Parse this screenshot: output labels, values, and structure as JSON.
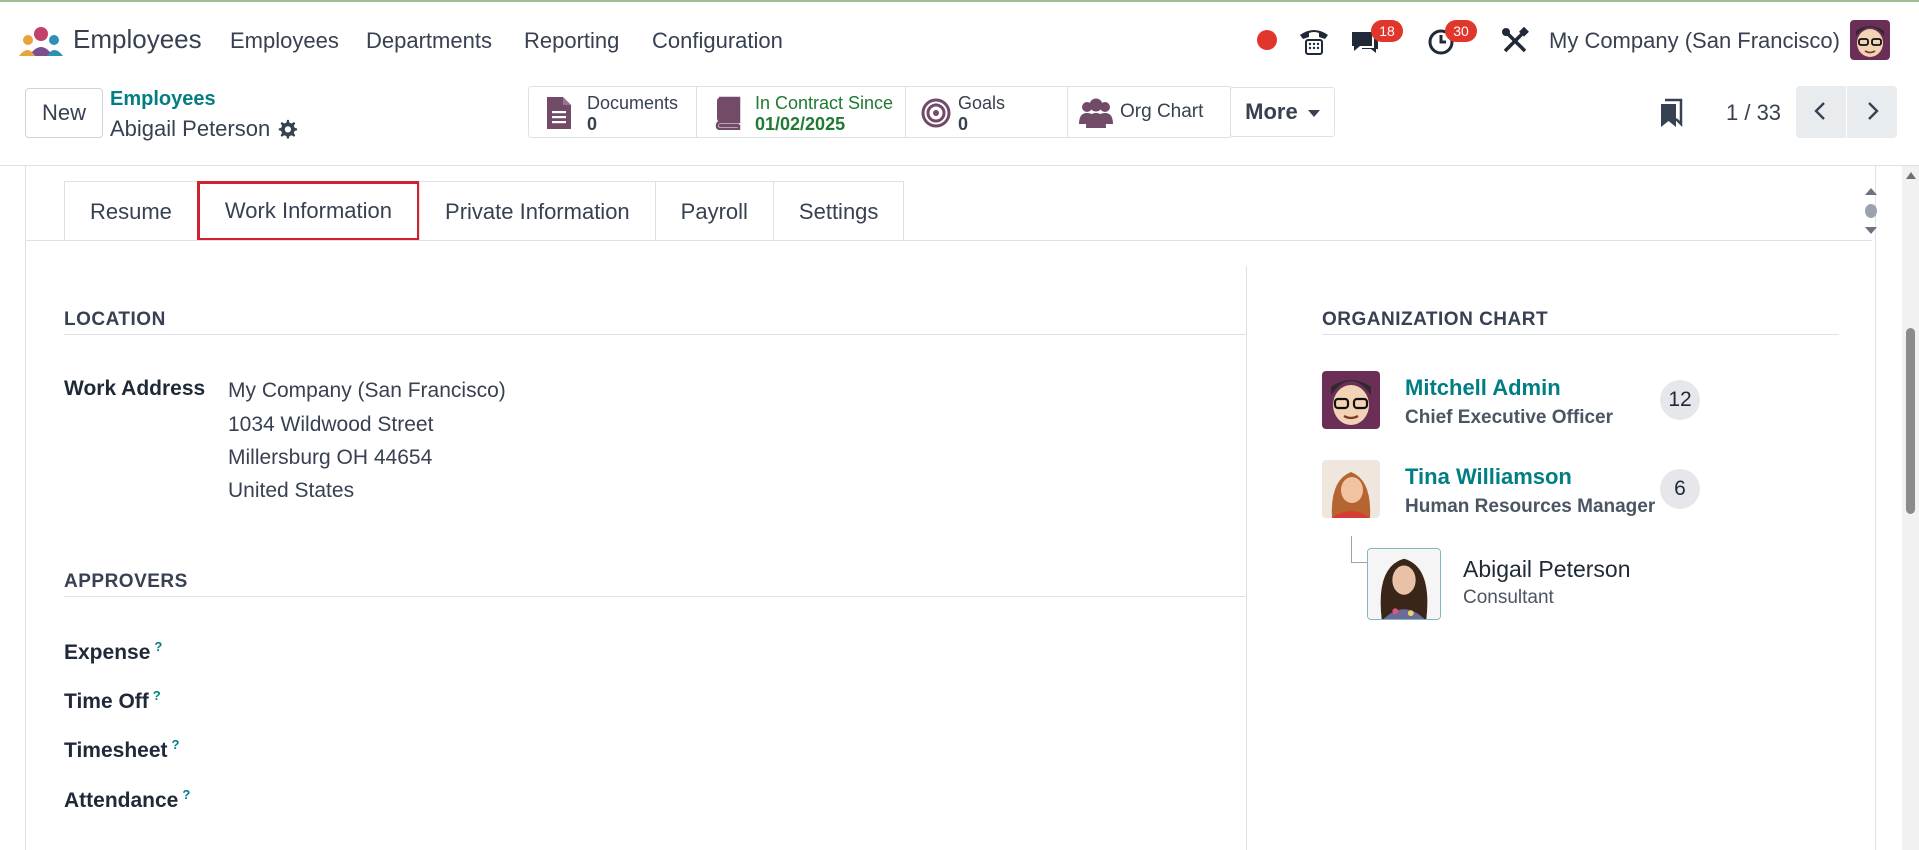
{
  "navbar": {
    "app_name": "Employees",
    "menu": [
      "Employees",
      "Departments",
      "Reporting",
      "Configuration"
    ],
    "messages_count": "18",
    "activities_count": "30",
    "company": "My Company (San Francisco)"
  },
  "control": {
    "new_label": "New",
    "breadcrumb_parent": "Employees",
    "breadcrumb_current": "Abigail Peterson",
    "smart_buttons": {
      "documents_label": "Documents",
      "documents_value": "0",
      "contract_label": "In Contract Since",
      "contract_value": "01/02/2025",
      "goals_label": "Goals",
      "goals_value": "0",
      "org_chart_label": "Org Chart"
    },
    "more_label": "More",
    "pager": "1 / 33"
  },
  "tabs": [
    "Resume",
    "Work Information",
    "Private Information",
    "Payroll",
    "Settings"
  ],
  "active_tab": "Work Information",
  "location": {
    "title": "LOCATION",
    "work_address_label": "Work Address",
    "address_lines": [
      "My Company (San Francisco)",
      "1034 Wildwood Street",
      "Millersburg OH 44654",
      "United States"
    ]
  },
  "approvers": {
    "title": "APPROVERS",
    "fields": [
      "Expense",
      "Time Off",
      "Timesheet",
      "Attendance"
    ],
    "help_mark": "?"
  },
  "org_chart": {
    "title": "ORGANIZATION CHART",
    "managers": [
      {
        "name": "Mitchell Admin",
        "job": "Chief Executive Officer",
        "count": "12"
      },
      {
        "name": "Tina Williamson",
        "job": "Human Resources Manager",
        "count": "6"
      }
    ],
    "self": {
      "name": "Abigail Peterson",
      "job": "Consultant"
    }
  },
  "colors": {
    "accent_teal": "#017e84",
    "badge_red": "#e0362b",
    "active_tab_border": "#d1202e",
    "contract_green": "#1f7a32",
    "icon_purple": "#714b67"
  }
}
